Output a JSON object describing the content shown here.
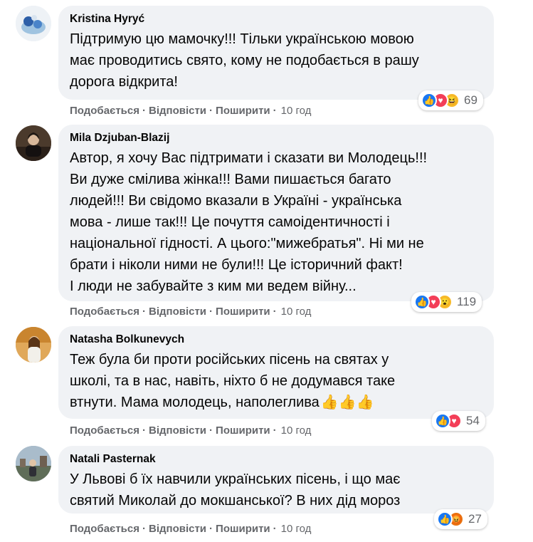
{
  "comments": [
    {
      "author": "Kristina Hyryć",
      "text": "Підтримую цю мамочку!!! Тільки українською мовою\nмає проводитись свято, кому не подобається в рашу\nдорога відкрита!",
      "thumbs": "",
      "reaction_icons": [
        "like-icon",
        "love-icon",
        "haha-icon"
      ],
      "reaction_count": "69",
      "actions": {
        "like": "Подобається",
        "reply": "Відповісти",
        "share": "Поширити",
        "time": "10 год"
      }
    },
    {
      "author": "Mila Dzjuban-Blazij",
      "text": "Автор, я хочу Вас підтримати і сказати ви Молодець!!!\nВи дуже смілива жінка!!! Вами пишається багато\nлюдей!!! Ви свідомо вказали в Україні - українська\nмова - лише так!!! Це почуття самоідентичності і\nнаціональної гідності. А цього:\"мижебратья\". Ні ми не\nбрати і ніколи ними не були!!! Це історичний факт!\nІ люди не забувайте з ким ми ведем війну...",
      "thumbs": "",
      "reaction_icons": [
        "like-icon",
        "love-icon",
        "wow-icon"
      ],
      "reaction_count": "119",
      "actions": {
        "like": "Подобається",
        "reply": "Відповісти",
        "share": "Поширити",
        "time": "10 год"
      }
    },
    {
      "author": "Natasha Bolkunevych",
      "text": "Теж була би проти російських пісень на святах у\nшколі, та в нас, навіть, ніхто б не додумався таке\nвтнути. Мама молодець, наполеглива",
      "thumbs": "👍👍👍",
      "reaction_icons": [
        "like-icon",
        "love-icon"
      ],
      "reaction_count": "54",
      "actions": {
        "like": "Подобається",
        "reply": "Відповісти",
        "share": "Поширити",
        "time": "10 год"
      }
    },
    {
      "author": "Natali Pasternak",
      "text": "У Львові б їх навчили українських пісень, і що має\nсвятий Миколай до мокшанської? В них дід мороз",
      "thumbs": "",
      "reaction_icons": [
        "like-icon",
        "angry-icon"
      ],
      "reaction_count": "27",
      "actions": {
        "like": "Подобається",
        "reply": "Відповісти",
        "share": "Поширити",
        "time": "10 год"
      }
    }
  ],
  "colors": {
    "bubble": "#f0f2f5",
    "secondary_text": "#65676b",
    "like_blue": "#1877f2",
    "love_red": "#f33e58",
    "haha_yellow": "#f7b928",
    "angry_orange": "#e9710f"
  }
}
